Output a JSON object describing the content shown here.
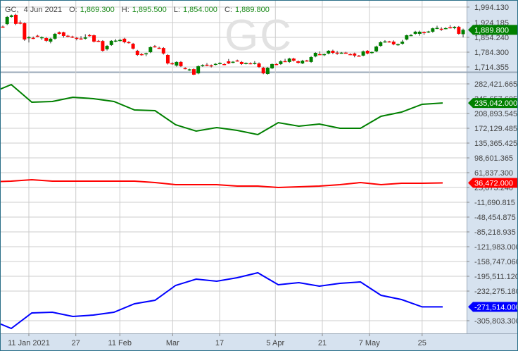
{
  "legend": {
    "symbol": "GC,",
    "date": "4 Jun 2021",
    "o_label": "O:",
    "o": "1,869.300",
    "h_label": "H:",
    "h": "1,895.500",
    "l_label": "L:",
    "l": "1,854.000",
    "c_label": "C:",
    "c": "1,889.800"
  },
  "watermark": "GC",
  "colors": {
    "up": "#008000",
    "down": "#ff0000",
    "line1": "#008000",
    "line2": "#ff0000",
    "line3": "#0000ff",
    "grid": "#cccccc",
    "axis_bg": "#d6e2ef"
  },
  "chart_data": [
    {
      "type": "candlestick",
      "title": "GC",
      "y_ticks": [
        "1,994.130",
        "1,924.185",
        "1,854.240",
        "1,784.300",
        "1,714.355"
      ],
      "ylim": [
        1680,
        1997
      ],
      "last_price_tag": "1,889.800",
      "ohlc": [
        [
          1905,
          1910,
          1900,
          1903
        ],
        [
          1917,
          1955,
          1912,
          1951
        ],
        [
          1951,
          1962,
          1948,
          1958
        ],
        [
          1961,
          1966,
          1912,
          1918
        ],
        [
          1924,
          1934,
          1916,
          1921
        ],
        [
          1921,
          1925,
          1838,
          1844
        ],
        [
          1853,
          1860,
          1830,
          1855
        ],
        [
          1852,
          1858,
          1846,
          1850
        ],
        [
          1862,
          1866,
          1856,
          1860
        ],
        [
          1853,
          1859,
          1842,
          1855
        ],
        [
          1851,
          1856,
          1832,
          1838
        ],
        [
          1834,
          1852,
          1826,
          1848
        ],
        [
          1848,
          1875,
          1843,
          1871
        ],
        [
          1878,
          1882,
          1868,
          1871
        ],
        [
          1878,
          1881,
          1853,
          1861
        ],
        [
          1862,
          1866,
          1855,
          1859
        ],
        [
          1858,
          1862,
          1851,
          1856
        ],
        [
          1852,
          1856,
          1840,
          1850
        ],
        [
          1849,
          1860,
          1843,
          1846
        ],
        [
          1848,
          1869,
          1844,
          1854
        ],
        [
          1865,
          1870,
          1858,
          1862
        ],
        [
          1864,
          1868,
          1830,
          1834
        ],
        [
          1838,
          1842,
          1832,
          1836
        ],
        [
          1837,
          1841,
          1787,
          1791
        ],
        [
          1798,
          1818,
          1792,
          1814
        ],
        [
          1818,
          1841,
          1814,
          1838
        ],
        [
          1836,
          1846,
          1831,
          1839
        ],
        [
          1840,
          1848,
          1834,
          1842
        ],
        [
          1848,
          1852,
          1826,
          1831
        ],
        [
          1832,
          1836,
          1825,
          1830
        ],
        [
          1824,
          1828,
          1797,
          1801
        ],
        [
          1791,
          1795,
          1767,
          1771
        ],
        [
          1775,
          1780,
          1768,
          1773
        ],
        [
          1776,
          1782,
          1765,
          1779
        ],
        [
          1784,
          1812,
          1780,
          1808
        ],
        [
          1812,
          1818,
          1806,
          1810
        ],
        [
          1805,
          1810,
          1799,
          1803
        ],
        [
          1804,
          1808,
          1773,
          1778
        ],
        [
          1771,
          1775,
          1726,
          1731
        ],
        [
          1732,
          1736,
          1725,
          1729
        ],
        [
          1721,
          1741,
          1716,
          1738
        ],
        [
          1738,
          1742,
          1714,
          1718
        ],
        [
          1709,
          1713,
          1703,
          1706
        ],
        [
          1700,
          1706,
          1696,
          1703
        ],
        [
          1704,
          1708,
          1676,
          1678
        ],
        [
          1684,
          1722,
          1680,
          1718
        ],
        [
          1720,
          1727,
          1715,
          1723
        ],
        [
          1725,
          1733,
          1718,
          1723
        ],
        [
          1722,
          1726,
          1712,
          1720
        ],
        [
          1726,
          1732,
          1722,
          1729
        ],
        [
          1730,
          1737,
          1726,
          1733
        ],
        [
          1728,
          1732,
          1723,
          1726
        ],
        [
          1741,
          1752,
          1728,
          1731
        ],
        [
          1736,
          1742,
          1732,
          1739
        ],
        [
          1745,
          1749,
          1740,
          1743
        ],
        [
          1738,
          1742,
          1724,
          1728
        ],
        [
          1730,
          1736,
          1726,
          1733
        ],
        [
          1732,
          1736,
          1727,
          1730
        ],
        [
          1730,
          1742,
          1726,
          1733
        ],
        [
          1731,
          1736,
          1710,
          1714
        ],
        [
          1711,
          1715,
          1680,
          1684
        ],
        [
          1681,
          1714,
          1678,
          1711
        ],
        [
          1708,
          1731,
          1704,
          1728
        ],
        [
          1728,
          1732,
          1724,
          1726
        ],
        [
          1728,
          1746,
          1724,
          1741
        ],
        [
          1742,
          1753,
          1738,
          1740
        ],
        [
          1738,
          1758,
          1734,
          1754
        ],
        [
          1754,
          1758,
          1740,
          1744
        ],
        [
          1741,
          1745,
          1730,
          1734
        ],
        [
          1731,
          1748,
          1728,
          1744
        ],
        [
          1745,
          1748,
          1740,
          1743
        ],
        [
          1738,
          1766,
          1734,
          1761
        ],
        [
          1764,
          1784,
          1760,
          1781
        ],
        [
          1775,
          1788,
          1770,
          1773
        ],
        [
          1773,
          1778,
          1766,
          1775
        ],
        [
          1778,
          1794,
          1774,
          1791
        ],
        [
          1791,
          1796,
          1775,
          1781
        ],
        [
          1782,
          1790,
          1772,
          1780
        ],
        [
          1780,
          1785,
          1777,
          1782
        ],
        [
          1782,
          1786,
          1778,
          1780
        ],
        [
          1775,
          1779,
          1770,
          1773
        ],
        [
          1778,
          1782,
          1760,
          1768
        ],
        [
          1768,
          1771,
          1764,
          1766
        ],
        [
          1768,
          1792,
          1765,
          1788
        ],
        [
          1791,
          1794,
          1774,
          1778
        ],
        [
          1783,
          1788,
          1776,
          1785
        ],
        [
          1788,
          1815,
          1784,
          1811
        ],
        [
          1814,
          1836,
          1810,
          1831
        ],
        [
          1833,
          1841,
          1829,
          1835
        ],
        [
          1835,
          1838,
          1830,
          1833
        ],
        [
          1834,
          1840,
          1817,
          1821
        ],
        [
          1820,
          1825,
          1814,
          1822
        ],
        [
          1824,
          1842,
          1820,
          1834
        ],
        [
          1844,
          1867,
          1840,
          1864
        ],
        [
          1863,
          1870,
          1860,
          1865
        ],
        [
          1871,
          1885,
          1867,
          1881
        ],
        [
          1871,
          1886,
          1862,
          1881
        ],
        [
          1879,
          1883,
          1866,
          1876
        ],
        [
          1880,
          1885,
          1875,
          1882
        ],
        [
          1881,
          1900,
          1876,
          1897
        ],
        [
          1897,
          1909,
          1893,
          1899
        ],
        [
          1895,
          1902,
          1885,
          1893
        ],
        [
          1896,
          1902,
          1892,
          1898
        ],
        [
          1902,
          1912,
          1896,
          1900
        ],
        [
          1898,
          1907,
          1893,
          1904
        ],
        [
          1904,
          1908,
          1867,
          1871
        ],
        [
          1869.3,
          1895.5,
          1854.0,
          1889.8
        ]
      ]
    },
    {
      "type": "line",
      "y_ticks": [
        "282,421.665",
        "245,657.605",
        "208,893.545",
        "172,129.485",
        "135,365.425",
        "98,601.365",
        "61,837.300",
        "25,073.240",
        "-11,690.815",
        "-48,454.875",
        "-85,218.935",
        "-121,983.000",
        "-158,747.060",
        "-195,511.120",
        "-232,275.180",
        "-305,803.300"
      ],
      "ylim": [
        -339000,
        291000
      ],
      "x": [
        "2020-12-29",
        "2021-01-05",
        "2021-01-12",
        "2021-01-19",
        "2021-01-26",
        "2021-02-02",
        "2021-02-09",
        "2021-02-16",
        "2021-02-23",
        "2021-03-02",
        "2021-03-09",
        "2021-03-16",
        "2021-03-23",
        "2021-03-30",
        "2021-04-06",
        "2021-04-13",
        "2021-04-20",
        "2021-04-27",
        "2021-05-04",
        "2021-05-11",
        "2021-05-18",
        "2021-05-25",
        "2021-06-01"
      ],
      "series": [
        {
          "color": "#008000",
          "last_tag": "235,042.000",
          "values": [
            259663,
            280671,
            236903,
            238653,
            249157,
            245656,
            238653,
            217645,
            215894,
            180880,
            165124,
            173877,
            166874,
            156370,
            186132,
            177379,
            182630,
            172126,
            172126,
            201891,
            212395,
            231653,
            235042
          ]
        },
        {
          "color": "#ff0000",
          "last_tag": "36,472.000",
          "values": [
            39074,
            40825,
            44326,
            40825,
            40825,
            40825,
            40825,
            40825,
            37324,
            32071,
            32071,
            32071,
            28570,
            28570,
            25069,
            26819,
            28570,
            32071,
            37324,
            32071,
            35573,
            35573,
            36472
          ]
        },
        {
          "color": "#0000ff",
          "last_tag": "-271,514.000",
          "values": [
            -304063,
            -325071,
            -286556,
            -284805,
            -295309,
            -291808,
            -284805,
            -263797,
            -255044,
            -218280,
            -202524,
            -207776,
            -199023,
            -186768,
            -216530,
            -211278,
            -220031,
            -213028,
            -209527,
            -242790,
            -253294,
            -271514,
            -271514
          ]
        }
      ]
    }
  ],
  "x_axis": {
    "ticks": [
      {
        "date": "2021-01-11",
        "label": "11 Jan 2021"
      },
      {
        "date": "2021-01-27",
        "label": "27"
      },
      {
        "date": "2021-02-11",
        "label": "11 Feb"
      },
      {
        "date": "2021-03-01",
        "label": "Mar"
      },
      {
        "date": "2021-03-17",
        "label": "17"
      },
      {
        "date": "2021-04-05",
        "label": "5 Apr"
      },
      {
        "date": "2021-04-21",
        "label": "21"
      },
      {
        "date": "2021-05-07",
        "label": "7 May"
      },
      {
        "date": "2021-05-25",
        "label": "25"
      }
    ]
  }
}
